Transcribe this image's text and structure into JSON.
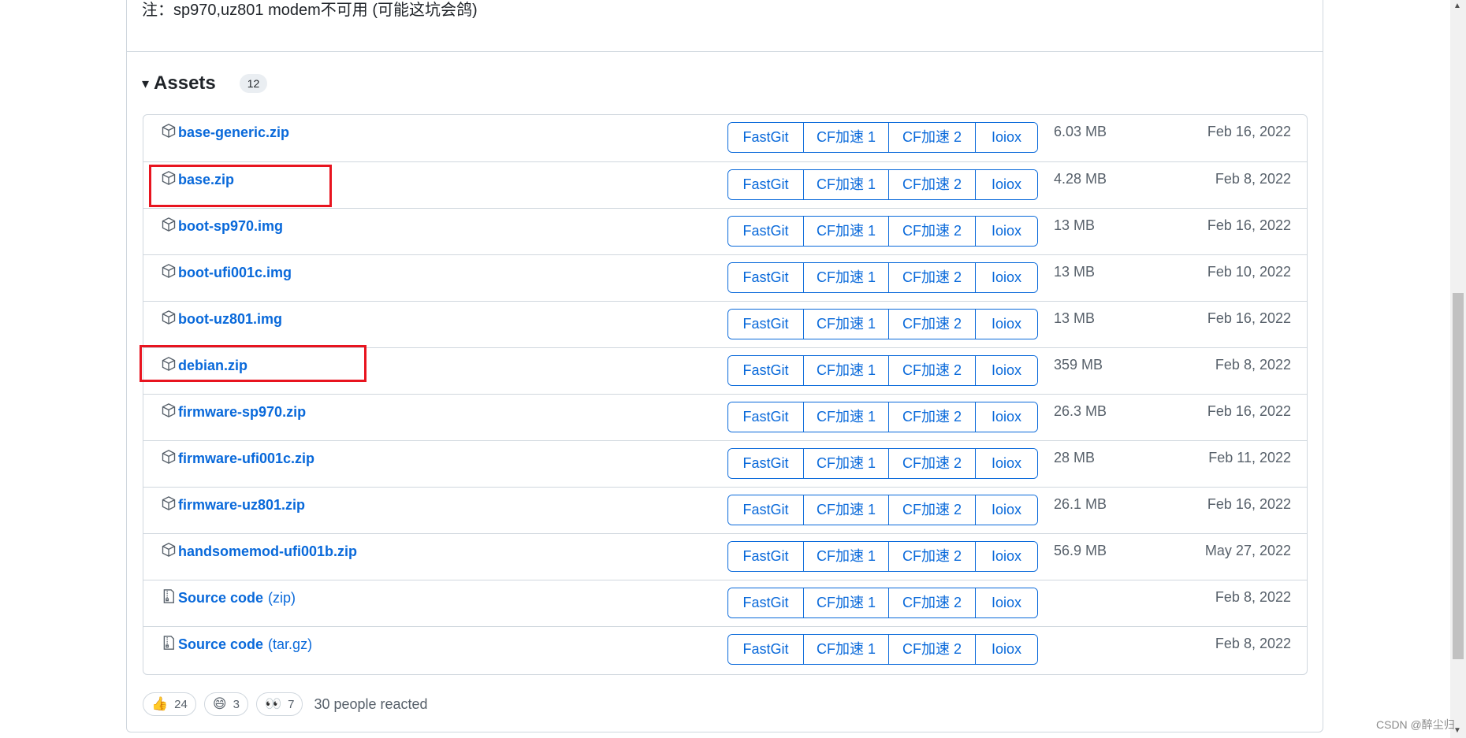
{
  "note": "注：sp970,uz801 modem不可用 (可能这坑会鸽)",
  "assets": {
    "title": "Assets",
    "count": "12"
  },
  "mirror_labels": [
    "FastGit",
    "CF加速 1",
    "CF加速 2",
    "Ioiox"
  ],
  "rows": [
    {
      "name": "base-generic.zip",
      "suffix": "",
      "icon": "package-icon",
      "size": "6.03 MB",
      "date": "Feb 16, 2022"
    },
    {
      "name": "base.zip",
      "suffix": "",
      "icon": "package-icon",
      "size": "4.28 MB",
      "date": "Feb 8, 2022"
    },
    {
      "name": "boot-sp970.img",
      "suffix": "",
      "icon": "package-icon",
      "size": "13 MB",
      "date": "Feb 16, 2022"
    },
    {
      "name": "boot-ufi001c.img",
      "suffix": "",
      "icon": "package-icon",
      "size": "13 MB",
      "date": "Feb 10, 2022"
    },
    {
      "name": "boot-uz801.img",
      "suffix": "",
      "icon": "package-icon",
      "size": "13 MB",
      "date": "Feb 16, 2022"
    },
    {
      "name": "debian.zip",
      "suffix": "",
      "icon": "package-icon",
      "size": "359 MB",
      "date": "Feb 8, 2022"
    },
    {
      "name": "firmware-sp970.zip",
      "suffix": "",
      "icon": "package-icon",
      "size": "26.3 MB",
      "date": "Feb 16, 2022"
    },
    {
      "name": "firmware-ufi001c.zip",
      "suffix": "",
      "icon": "package-icon",
      "size": "28 MB",
      "date": "Feb 11, 2022"
    },
    {
      "name": "firmware-uz801.zip",
      "suffix": "",
      "icon": "package-icon",
      "size": "26.1 MB",
      "date": "Feb 16, 2022"
    },
    {
      "name": "handsomemod-ufi001b.zip",
      "suffix": "",
      "icon": "package-icon",
      "size": "56.9 MB",
      "date": "May 27, 2022"
    },
    {
      "name": "Source code",
      "suffix": "(zip)",
      "icon": "file-zip-icon",
      "size": "",
      "date": "Feb 8, 2022"
    },
    {
      "name": "Source code",
      "suffix": "(tar.gz)",
      "icon": "file-zip-icon",
      "size": "",
      "date": "Feb 8, 2022"
    }
  ],
  "reactions": [
    {
      "emoji": "👍",
      "icon": "thumbs-up-icon",
      "count": "24"
    },
    {
      "emoji": "😄",
      "icon": "smile-icon",
      "count": "3"
    },
    {
      "emoji": "👀",
      "icon": "eyes-icon",
      "count": "7"
    }
  ],
  "reactions_text": "30 people reacted",
  "watermark": "CSDN @醉尘归",
  "colors": {
    "link": "#0969da",
    "highlight": "#e8141f",
    "border": "#d0d7de"
  }
}
